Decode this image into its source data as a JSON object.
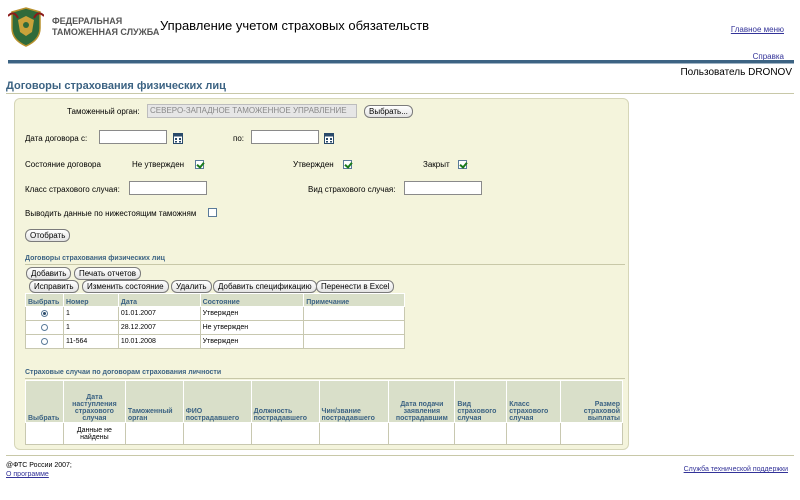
{
  "header": {
    "logo_line1": "ФЕДЕРАЛЬНАЯ",
    "logo_line2": "ТАМОЖЕННАЯ СЛУЖБА",
    "app_title": "Управление учетом страховых обязательств",
    "main_menu": "Главное меню",
    "help": "Справка",
    "user": "Пользователь DRONOV"
  },
  "page_title": "Договоры страхования физических лиц",
  "filters": {
    "customs_label": "Таможенный орган:",
    "customs_value": "СЕВЕРО-ЗАПАДНОЕ ТАМОЖЕННОЕ УПРАВЛЕНИЕ",
    "select_button": "Выбрать...",
    "contract_date_label": "Дата договора  с:",
    "date_from": "",
    "date_to_label": "по:",
    "date_to": "",
    "state_label": "Состояние договора",
    "state_not_approved": "Не утвержден",
    "state_approved": "Утвержден",
    "state_closed": "Закрыт",
    "insured_class_label": "Класс страхового случая:",
    "insured_class_value": "",
    "insured_type_label": "Вид страхового случая:",
    "insured_type_value": "",
    "subordinate_label": "Выводить данные по нижестоящим таможням",
    "filter_button": "Отобрать"
  },
  "contracts": {
    "title": "Договоры страхования физических лиц",
    "buttons": {
      "add": "Добавить",
      "print": "Печать отчетов",
      "edit": "Исправить",
      "change_state": "Изменить состояние",
      "delete": "Удалить",
      "add_spec": "Добавить спецификацию",
      "export": "Перенести в Excel"
    },
    "columns": [
      "Выбрать",
      "Номер",
      "Дата",
      "Состояние",
      "Примечание"
    ],
    "rows": [
      {
        "number": "1",
        "date": "01.01.2007",
        "state": "Утвержден",
        "note": ""
      },
      {
        "number": "1",
        "date": "28.12.2007",
        "state": "Не утвержден",
        "note": ""
      },
      {
        "number": "11-564",
        "date": "10.01.2008",
        "state": "Утвержден",
        "note": ""
      }
    ]
  },
  "cases": {
    "title": "Страховые случаи по договорам страхования личности",
    "columns": [
      "Выбрать",
      "Дата наступления страхового случая",
      "Таможенный орган",
      "ФИО пострадавшего",
      "Должность пострадавшего",
      "Чин/звание пострадавшего",
      "Дата подачи заявления пострадавшим",
      "Вид страхового случая",
      "Класс страхового случая",
      "Размер страховой выплаты"
    ],
    "empty_text": "Данные не найдены"
  },
  "footer": {
    "copyright": "@ФТС России 2007;",
    "about": "О программе",
    "support": "Служба технической поддержки"
  },
  "colors": {
    "accent": "#3c6383",
    "panel_bg": "#f4f4dc",
    "table_header": "#d9dfc9"
  }
}
